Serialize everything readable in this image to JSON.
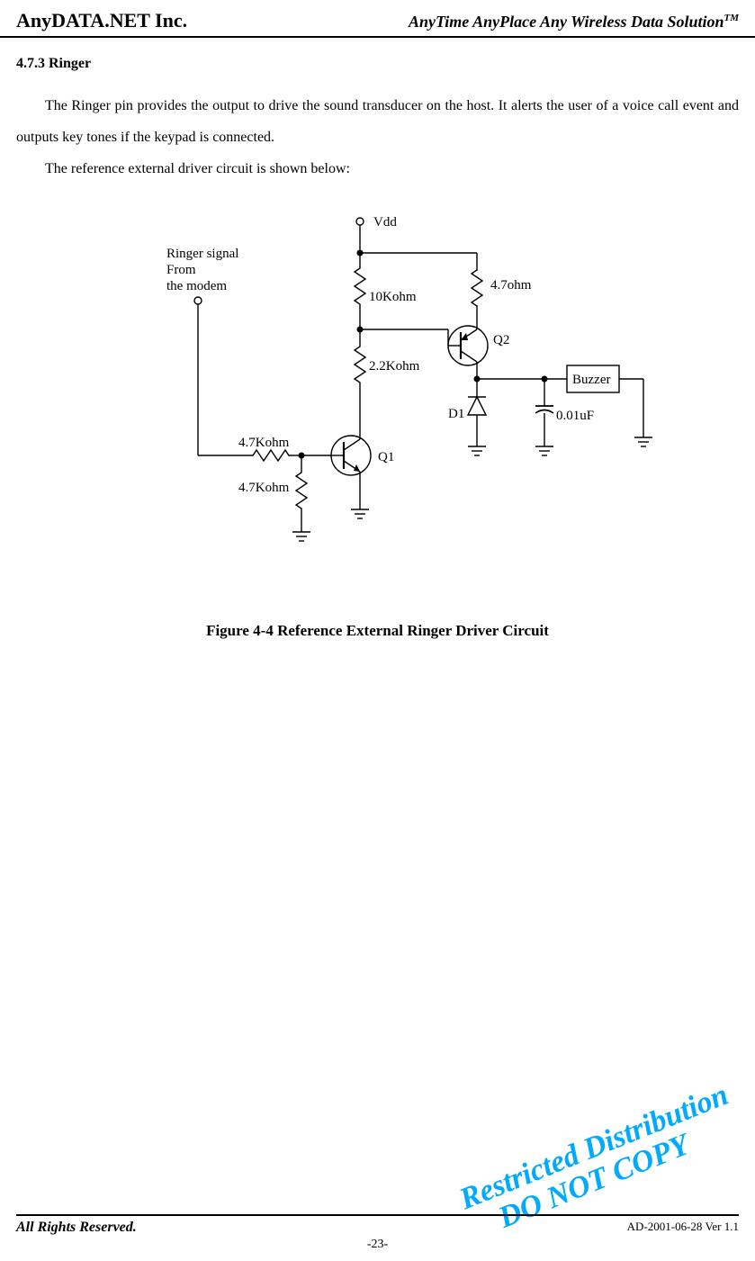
{
  "header": {
    "company": "AnyDATA.NET Inc.",
    "tagline": "AnyTime AnyPlace Any Wireless Data Solution",
    "tagline_sup": "TM"
  },
  "section": {
    "number_title": "4.7.3 Ringer",
    "para1": "The Ringer pin provides the output to drive the sound transducer on the host. It alerts the user of a voice call event and outputs key tones if the keypad is connected.",
    "para2": "The reference external driver circuit is shown below:"
  },
  "circuit": {
    "ringer_signal_l1": "Ringer signal",
    "ringer_signal_l2": "From",
    "ringer_signal_l3": "the modem",
    "vdd": "Vdd",
    "r_10k": "10Kohm",
    "r_22k": "2.2Kohm",
    "r_47k_a": "4.7Kohm",
    "r_47k_b": "4.7Kohm",
    "r_47ohm": "4.7ohm",
    "q1": "Q1",
    "q2": "Q2",
    "d1": "D1",
    "c1": "0.01uF",
    "buzzer": "Buzzer"
  },
  "figure_caption": "Figure 4-4 Reference External Ringer Driver Circuit",
  "watermark": {
    "line1": "Restricted Distribution",
    "line2": "DO NOT COPY"
  },
  "footer": {
    "left": "All Rights Reserved.",
    "right": "AD-2001-06-28 Ver 1.1",
    "page": "-23-"
  }
}
